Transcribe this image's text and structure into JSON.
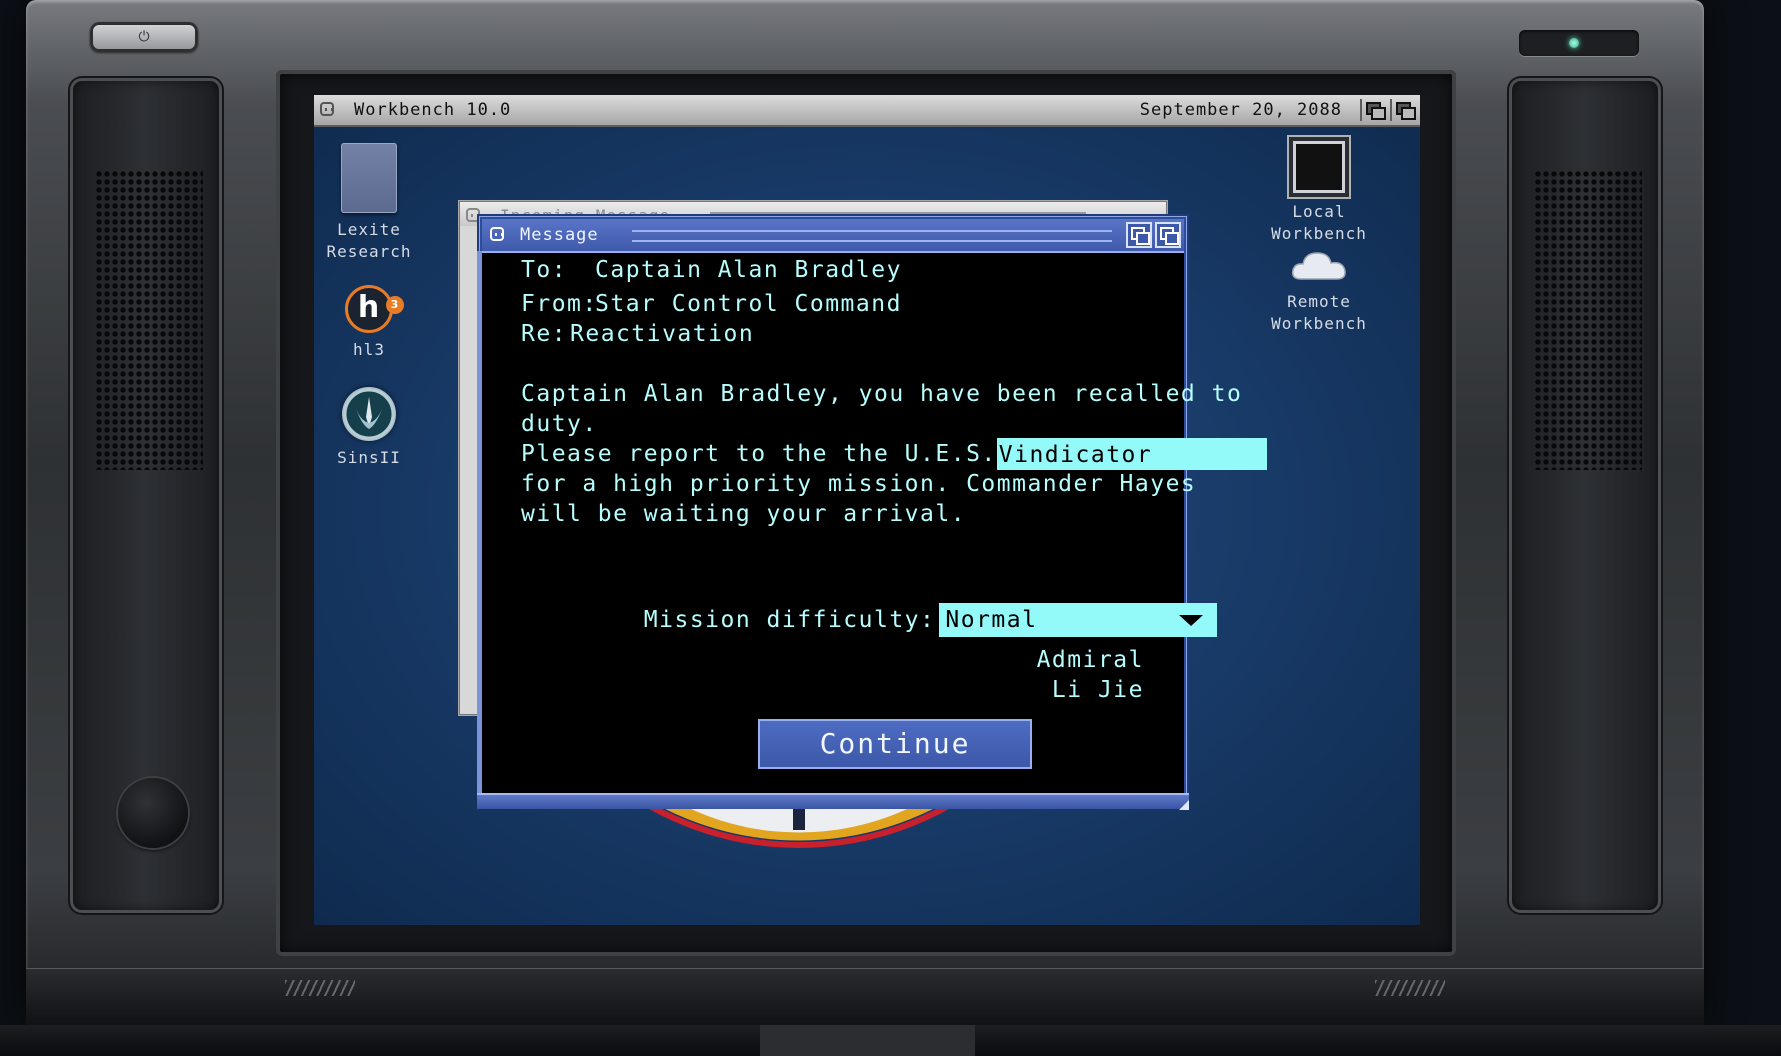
{
  "device": {
    "power_symbol": "⏻",
    "led_color": "#5ed8b5"
  },
  "menubar": {
    "title": "Workbench 10.0",
    "date": "September 20, 2088"
  },
  "desktop": {
    "left_icons": [
      {
        "label": "Lexite\nResearch",
        "icon": "drawer-icon"
      },
      {
        "label": "hl3",
        "icon": "hl3-icon",
        "badge_letter": "h",
        "badge_sup": "3"
      },
      {
        "label": "SinsII",
        "icon": "sins-emblem-icon"
      }
    ],
    "right_icons": [
      {
        "label": "Local\nWorkbench",
        "icon": "chip-icon"
      },
      {
        "label": "Remote\nWorkbench",
        "icon": "cloud-icon"
      }
    ]
  },
  "back_window": {
    "title": "Incoming Message"
  },
  "message_window": {
    "title": "Message",
    "to_label": "To:",
    "to_value": "Captain Alan Bradley",
    "from_label": "From:",
    "from_value": "Star Control Command",
    "re_label": "Re:",
    "re_value": "Reactivation",
    "body": {
      "line1": "Captain Alan Bradley, you have been recalled to",
      "line2": "duty.",
      "line3_prefix": "Please report to the the U.E.S.",
      "ship_name": "Vindicator",
      "line4": "for a high priority mission. Commander Hayes",
      "line5": "will be waiting your arrival."
    },
    "difficulty_label": "Mission difficulty:",
    "difficulty_value": "Normal",
    "signature": [
      "Admiral",
      "Li Jie"
    ],
    "continue_label": "Continue"
  },
  "colors": {
    "screen_bg": "#173965",
    "window_blue": "#3f5aaa",
    "text_cyan": "#b6fdfd",
    "field_cyan": "#93f9f9"
  }
}
